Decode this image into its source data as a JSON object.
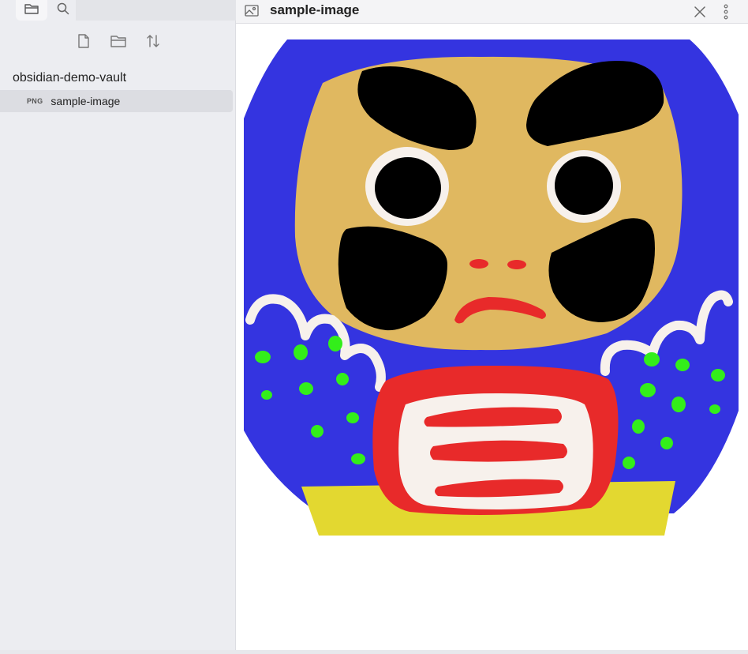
{
  "sidebar": {
    "tabs": [
      {
        "icon": "folder-icon"
      },
      {
        "icon": "search-icon"
      }
    ],
    "tools": [
      {
        "icon": "new-note-icon"
      },
      {
        "icon": "new-folder-icon"
      },
      {
        "icon": "sort-icon"
      }
    ],
    "vault_name": "obsidian-demo-vault",
    "files": [
      {
        "badge": "PNG",
        "name": "sample-image",
        "selected": true
      }
    ]
  },
  "view": {
    "title": "sample-image",
    "icon": "image-file-icon",
    "actions": [
      {
        "icon": "close-icon"
      },
      {
        "icon": "more-options-icon"
      }
    ]
  },
  "image": {
    "subject": "daruma-doll",
    "colors": {
      "background": "#3434e0",
      "face": "#e0b860",
      "brows": "#000000",
      "mouth": "#e82a2a",
      "belly_border": "#e82a2a",
      "belly": "#f7f1ec",
      "dots": "#33ee1a",
      "base": "#e3d830"
    }
  }
}
